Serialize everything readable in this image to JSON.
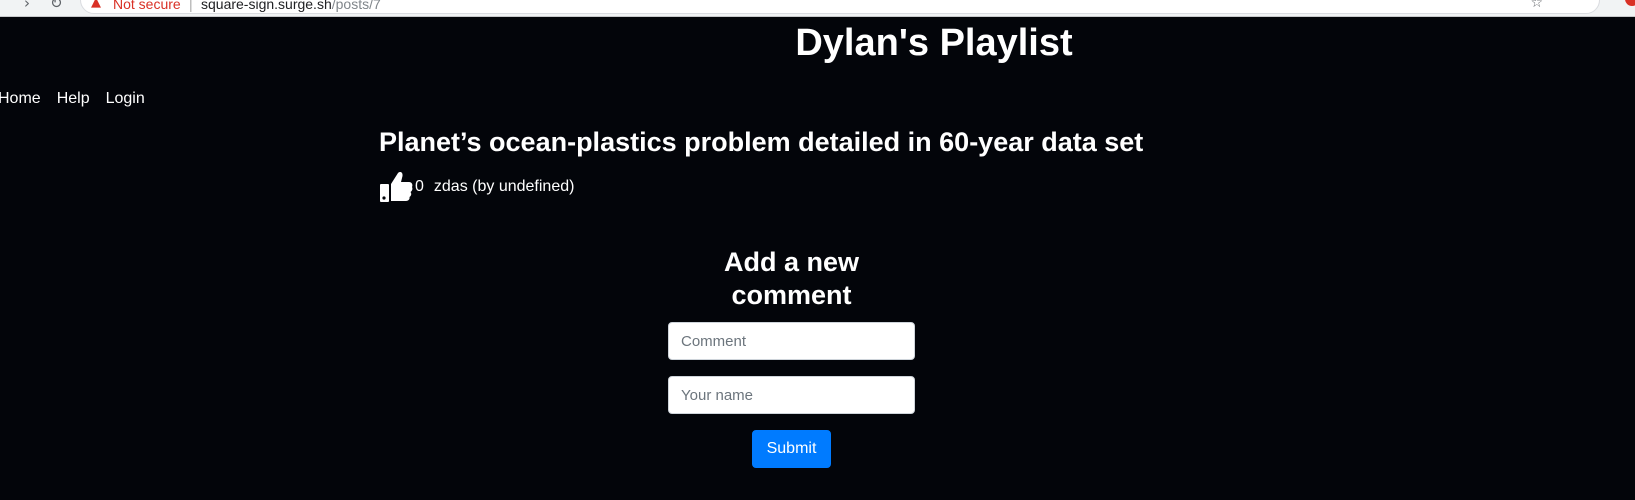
{
  "browser": {
    "back_icon": "arrow-left-icon",
    "reload_icon": "reload-icon",
    "security_label": "Not secure",
    "url_host": "square-sign.surge.sh",
    "url_path": "/posts/7",
    "bookmark_icon": "star-icon"
  },
  "site": {
    "title": "Dylan's Playlist"
  },
  "nav": {
    "items": [
      "Home",
      "Help",
      "Login"
    ]
  },
  "post": {
    "title": "Planet’s ocean-plastics problem detailed in 60-year data set",
    "like_icon": "thumbs-up-icon",
    "likes": "0",
    "author": "zdas (by undefined)"
  },
  "comment_form": {
    "heading": "Add a new comment",
    "comment_placeholder": "Comment",
    "name_placeholder": "Your name",
    "submit_label": "Submit"
  },
  "colors": {
    "background": "#03050a",
    "text": "#ffffff",
    "submit_button": "#007bff",
    "not_secure": "#d93025"
  }
}
